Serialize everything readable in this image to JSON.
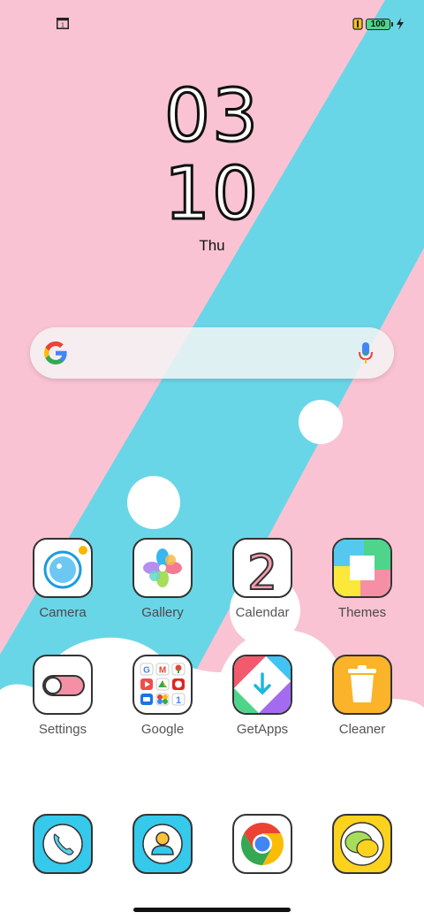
{
  "status_bar": {
    "notification_icon": "calendar-notification-icon",
    "notification_badge": "1",
    "battery_level": "100",
    "charging_icon": "bolt-icon"
  },
  "clock": {
    "hours": "03",
    "minutes": "10",
    "day": "Thu"
  },
  "search": {
    "placeholder": "",
    "left_icon": "google-g-icon",
    "right_icon": "microphone-icon"
  },
  "apps": [
    {
      "label": "Camera"
    },
    {
      "label": "Gallery"
    },
    {
      "label": "Calendar",
      "icon_text": "2"
    },
    {
      "label": "Themes"
    },
    {
      "label": "Settings"
    },
    {
      "label": "Google"
    },
    {
      "label": "GetApps"
    },
    {
      "label": "Cleaner"
    }
  ],
  "dock": [
    {
      "icon": "phone-icon"
    },
    {
      "icon": "contacts-icon"
    },
    {
      "icon": "chrome-icon"
    },
    {
      "icon": "messages-icon"
    }
  ],
  "colors": {
    "pink": "#f9c4d2",
    "cyan": "#6ad6e8",
    "white": "#ffffff"
  }
}
